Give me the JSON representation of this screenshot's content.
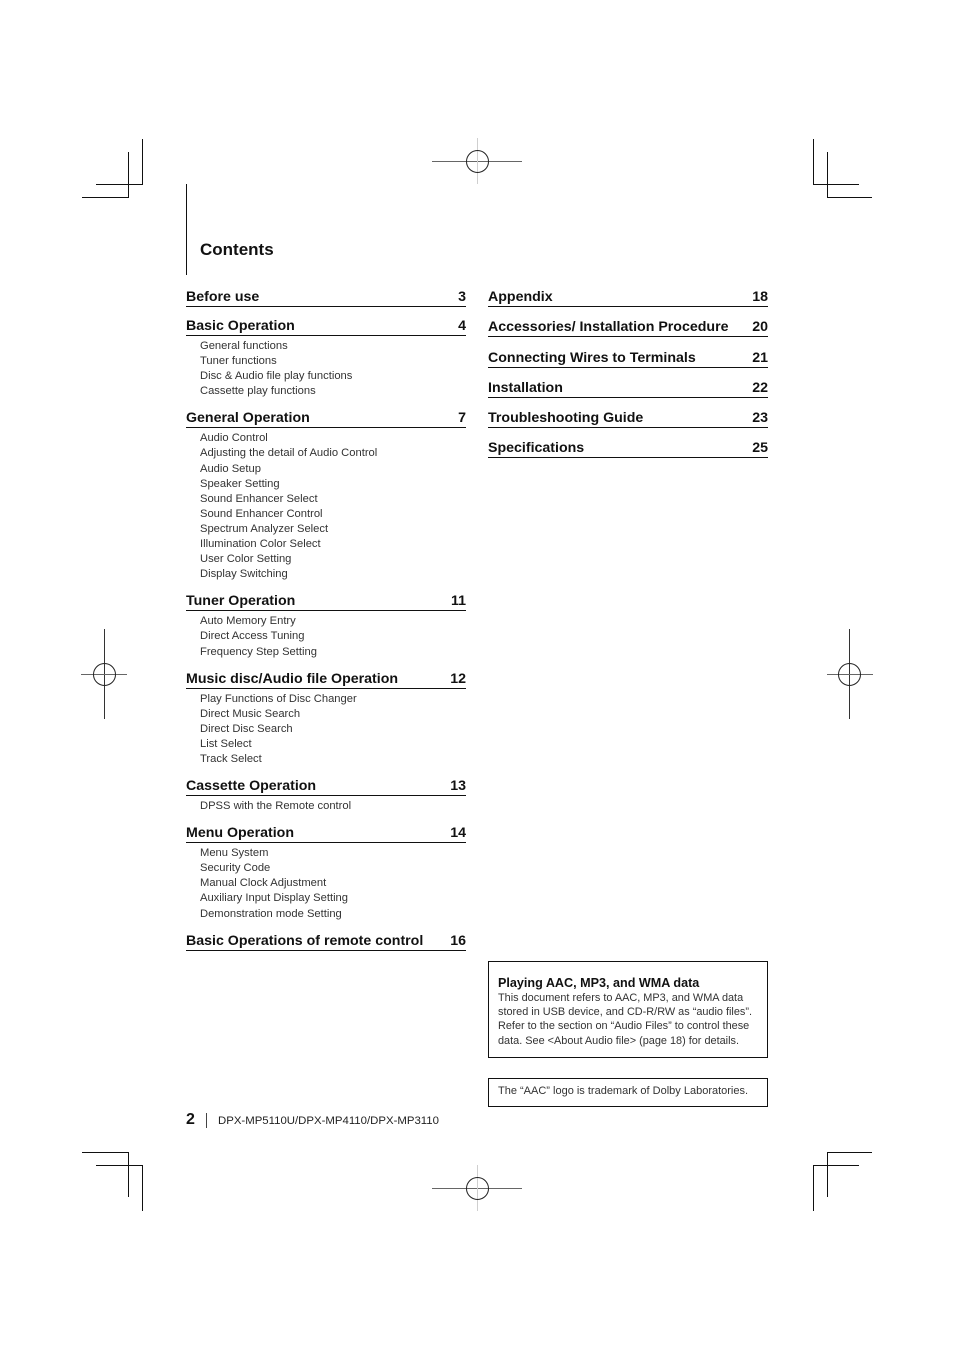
{
  "page": {
    "title": "Contents",
    "page_number": "2",
    "model_names": "DPX-MP5110U/DPX-MP4110/DPX-MP3110"
  },
  "toc_left": [
    {
      "title": "Before use",
      "page": "3",
      "subs": []
    },
    {
      "title": "Basic Operation",
      "page": "4",
      "subs": [
        "General functions",
        "Tuner functions",
        "Disc & Audio file play functions",
        "Cassette play functions"
      ]
    },
    {
      "title": "General Operation",
      "page": "7",
      "subs": [
        "Audio Control",
        "Adjusting the detail of Audio Control",
        "Audio Setup",
        "Speaker Setting",
        "Sound Enhancer Select",
        "Sound Enhancer Control",
        "Spectrum Analyzer Select",
        "Illumination Color Select",
        "User Color Setting",
        "Display Switching"
      ]
    },
    {
      "title": "Tuner Operation",
      "page": "11",
      "subs": [
        "Auto Memory Entry",
        "Direct Access Tuning",
        "Frequency Step Setting"
      ]
    },
    {
      "title": "Music disc/Audio file Operation",
      "page": "12",
      "subs": [
        "Play Functions of Disc Changer",
        "Direct Music Search",
        "Direct Disc Search",
        "List Select",
        "Track Select"
      ]
    },
    {
      "title": "Cassette Operation",
      "page": "13",
      "subs": [
        "DPSS with the Remote control"
      ]
    },
    {
      "title": "Menu Operation",
      "page": "14",
      "subs": [
        "Menu System",
        "Security Code",
        "Manual Clock Adjustment",
        "Auxiliary Input Display Setting",
        "Demonstration mode Setting"
      ]
    },
    {
      "title": "Basic Operations of remote control",
      "page": "16",
      "subs": []
    }
  ],
  "toc_right": [
    {
      "title": "Appendix",
      "page": "18"
    },
    {
      "title": "Accessories/ Installation Procedure",
      "page": "20"
    },
    {
      "title": "Connecting Wires to Terminals",
      "page": "21"
    },
    {
      "title": "Installation",
      "page": "22"
    },
    {
      "title": "Troubleshooting Guide",
      "page": "23"
    },
    {
      "title": "Specifications",
      "page": "25"
    }
  ],
  "info_box": {
    "title": "Playing AAC, MP3, and WMA data",
    "body": "This document refers to AAC, MP3, and WMA data stored in USB device, and CD-R/RW as “audio files”. Refer to the section on “Audio Files” to control these data. See <About Audio file> (page 18) for details."
  },
  "trademark_note": "The “AAC” logo is trademark of Dolby Laboratories."
}
